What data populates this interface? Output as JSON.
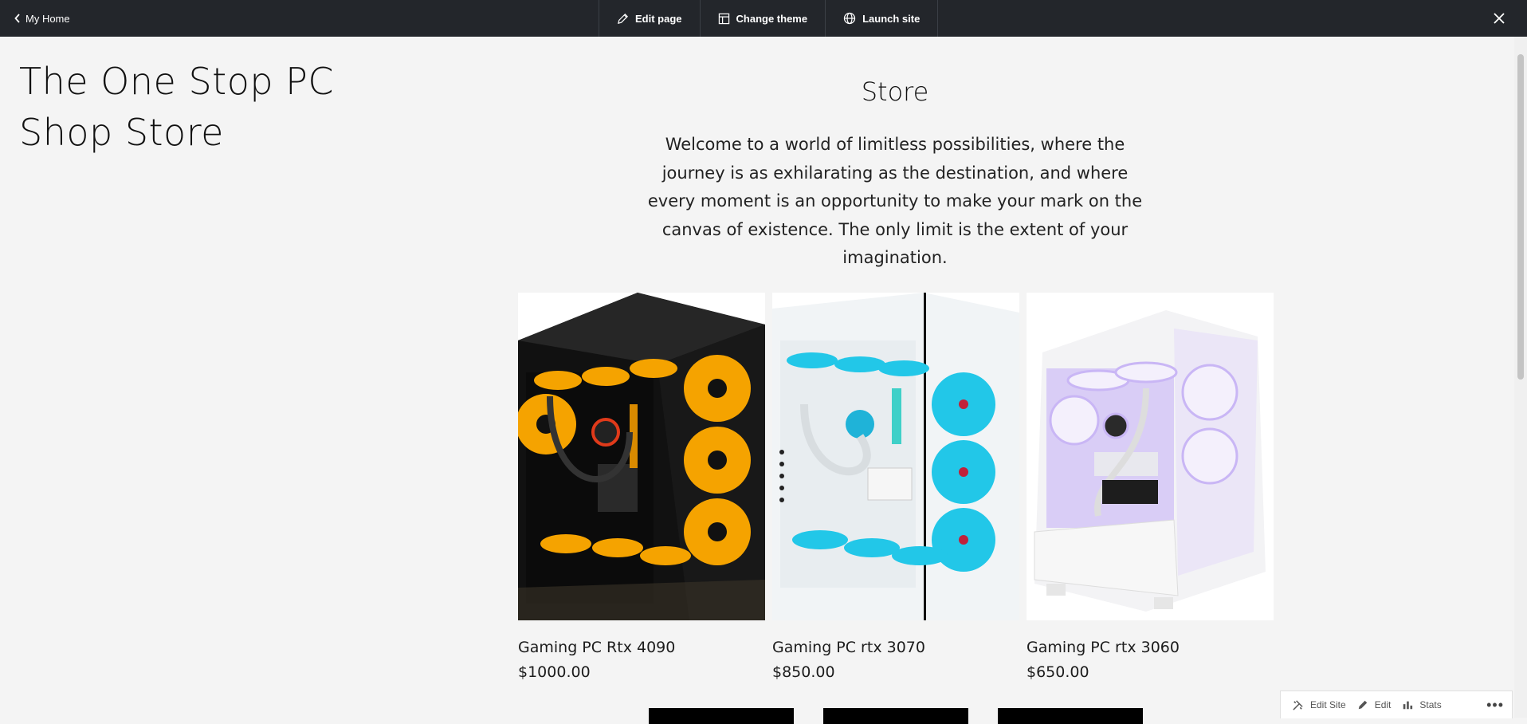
{
  "topbar": {
    "back_label": "My Home",
    "actions": [
      {
        "label": "Edit page",
        "icon": "pencil-icon"
      },
      {
        "label": "Change theme",
        "icon": "layout-icon"
      },
      {
        "label": "Launch site",
        "icon": "globe-icon"
      }
    ],
    "close_icon": "close-icon"
  },
  "site": {
    "title": "The One Stop PC Shop Store"
  },
  "store": {
    "heading": "Store",
    "description": "Welcome to a world of limitless possibilities, where the journey is as exhilarating as the destination, and where every moment is an opportunity to make your mark on the canvas of existence. The only limit is the extent of your imagination."
  },
  "products": [
    {
      "name": "Gaming PC Rtx 4090",
      "price": "$1000.00",
      "case_color": "black",
      "fan_color": "#f5a300"
    },
    {
      "name": "Gaming PC rtx 3070",
      "price": "$850.00",
      "case_color": "white",
      "fan_color": "#22c7e8"
    },
    {
      "name": "Gaming PC rtx 3060",
      "price": "$650.00",
      "case_color": "white",
      "fan_color": "#c9b6f5"
    }
  ],
  "adminbar": {
    "items": [
      {
        "label": "Edit Site",
        "icon": "tools-icon"
      },
      {
        "label": "Edit",
        "icon": "pencil-icon"
      },
      {
        "label": "Stats",
        "icon": "bar-chart-icon"
      }
    ],
    "more": "•••"
  },
  "colors": {
    "topbar_bg": "#23262b",
    "page_bg": "#f4f4f4",
    "button_bg": "#000000"
  }
}
